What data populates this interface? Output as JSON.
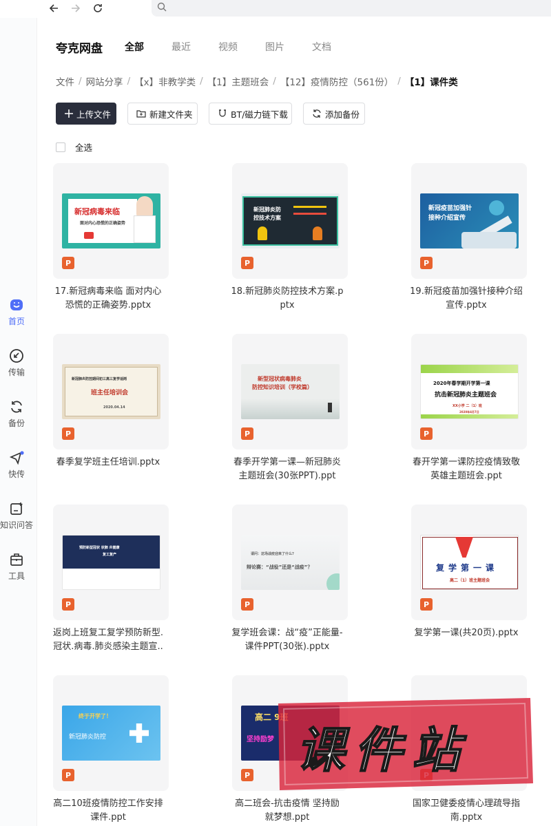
{
  "browser": {
    "back": "back",
    "forward": "forward",
    "refresh": "refresh",
    "search_icon": "search-icon"
  },
  "sidebar": {
    "items": [
      {
        "label": "首页",
        "icon": "home-icon",
        "active": true
      },
      {
        "label": "传输",
        "icon": "transfer-icon"
      },
      {
        "label": "备份",
        "icon": "backup-icon"
      },
      {
        "label": "快传",
        "icon": "quick-send-icon"
      },
      {
        "label": "知识问答",
        "icon": "qa-icon"
      },
      {
        "label": "工具",
        "icon": "toolbox-icon"
      }
    ]
  },
  "header": {
    "brand": "夸克网盘",
    "tabs": [
      "全部",
      "最近",
      "视频",
      "图片",
      "文档"
    ]
  },
  "breadcrumb": [
    "文件",
    "网站分享",
    "【x】非教学类",
    "【1】主题班会",
    "【12】疫情防控（561份）",
    "【1】课件类"
  ],
  "toolbar": {
    "upload": "上传文件",
    "new_folder": "新建文件夹",
    "bt": "BT/磁力链下载",
    "backup": "添加备份"
  },
  "select_all": "全选",
  "files": [
    {
      "name": [
        "17.新冠病毒来临 面对内心",
        "恐慌的正确姿势.pptx"
      ],
      "type": "P",
      "thumb_text": [
        "新冠病毒来临",
        "面对内心恐慌的正确姿势"
      ]
    },
    {
      "name": [
        "18.新冠肺炎防控技术方案.p",
        "ptx"
      ],
      "type": "P",
      "thumb_text": [
        "新冠肺炎防",
        "控技术方案"
      ]
    },
    {
      "name": [
        "19.新冠疫苗加强针接种介绍",
        "宣传.pptx"
      ],
      "type": "P",
      "thumb_text": [
        "新冠疫苗加强针",
        "接种介绍宣传"
      ]
    },
    {
      "name": [
        "春季复学班主任培训.pptx"
      ],
      "type": "P",
      "thumb_text": [
        "新冠肺炎防控期间初三高三复学适岗",
        "班主任培训会",
        "2020.04.14"
      ]
    },
    {
      "name": [
        "春季开学第一课—新冠肺炎",
        "主题班会(30张PPT).ppt"
      ],
      "type": "P",
      "thumb_text": [
        "新型冠状病毒肺炎",
        "防控知识培训（学校篇）"
      ]
    },
    {
      "name": [
        "春开学第一课防控疫情致敬",
        "英雄主题班会.ppt"
      ],
      "type": "P",
      "thumb_text": [
        "2020年春学期开学第一课",
        "抗击新冠肺炎主题班会",
        "XX小学 二（1）班",
        "2020年4月7日"
      ]
    },
    {
      "name": [
        "返岗上班复工复学预防新型.",
        "冠状.病毒.肺炎感染主题宣.."
      ],
      "type": "P",
      "thumb_text": [
        "预防新型冠状 状肺 炎健康",
        "复工复产"
      ]
    },
    {
      "name": [
        "复学班会课：战“疫”正能量-",
        "课件PPT(30张).pptx"
      ],
      "type": "P",
      "thumb_text": [
        "请问：这场战疫迎来了什么?",
        "辩论赛：“战役”还是“战疫”？"
      ]
    },
    {
      "name": [
        "复学第一课(共20页).pptx"
      ],
      "type": "P",
      "thumb_text": [
        "复学第一课",
        "高二（1）班主题班会"
      ]
    },
    {
      "name": [
        "高二10班疫情防控工作安排",
        "课件.ppt"
      ],
      "type": "P",
      "thumb_text": [
        "终于开学了！",
        "新冠肺炎防控"
      ]
    },
    {
      "name": [
        "高二班会-抗击疫情 坚持励",
        "就梦想.ppt"
      ],
      "type": "P",
      "thumb_text": [
        "高二 9班",
        "坚持励梦"
      ]
    },
    {
      "name": [
        "国家卫健委疫情心理疏导指",
        "南.pptx"
      ],
      "type": "P",
      "thumb_text": []
    }
  ],
  "watermark": {
    "text": "课件站"
  },
  "colors": {
    "accent": "#4f6ef7",
    "ppt_badge": "#e8622e",
    "primary_btn": "#2a2e3c",
    "watermark": "#d9243b"
  }
}
